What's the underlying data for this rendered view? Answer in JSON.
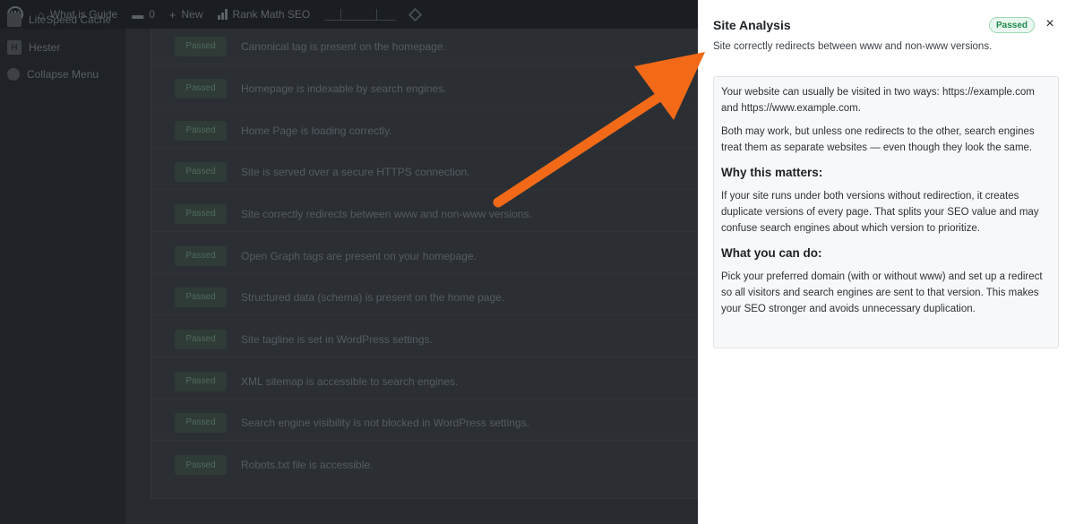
{
  "admin_bar": {
    "site_name": "What is Guide",
    "comments_count": "0",
    "new_label": "New",
    "rank_math_label": "Rank Math SEO"
  },
  "sidebar": {
    "items": [
      {
        "label": "LiteSpeed Cache",
        "icon": "litespeed-icon"
      },
      {
        "label": "Hester",
        "icon": "hester-icon"
      },
      {
        "label": "Collapse Menu",
        "icon": "collapse-icon"
      }
    ]
  },
  "checks": [
    {
      "status": "Passed",
      "text": "Canonical tag is present on the homepage."
    },
    {
      "status": "Passed",
      "text": "Homepage is indexable by search engines."
    },
    {
      "status": "Passed",
      "text": "Home Page is loading correctly."
    },
    {
      "status": "Passed",
      "text": "Site is served over a secure HTTPS connection."
    },
    {
      "status": "Passed",
      "text": "Site correctly redirects between www and non-www versions."
    },
    {
      "status": "Passed",
      "text": "Open Graph tags are present on your homepage."
    },
    {
      "status": "Passed",
      "text": "Structured data (schema) is present on the home page."
    },
    {
      "status": "Passed",
      "text": "Site tagline is set in WordPress settings."
    },
    {
      "status": "Passed",
      "text": "XML sitemap is accessible to search engines."
    },
    {
      "status": "Passed",
      "text": "Search engine visibility is not blocked in WordPress settings."
    },
    {
      "status": "Passed",
      "text": "Robots.txt file is accessible."
    }
  ],
  "drawer": {
    "title": "Site Analysis",
    "status_badge": "Passed",
    "close_glyph": "×",
    "subtitle": "Site correctly redirects between www and non-www versions.",
    "intro_1": "Your website can usually be visited in two ways: https://example.com and https://www.example.com.",
    "intro_2": "Both may work, but unless one redirects to the other, search engines treat them as separate websites — even though they look the same.",
    "why_heading": "Why this matters:",
    "why_text": "If your site runs under both versions without redirection, it creates duplicate versions of every page. That splits your SEO value and may confuse search engines about which version to prioritize.",
    "what_heading": "What you can do:",
    "what_text": "Pick your preferred domain (with or without www) and set up a redirect so all visitors and search engines are sent to that version. This makes your SEO stronger and avoids unnecessary duplication."
  },
  "colors": {
    "arrow": "#f26a18",
    "passed_badge_text": "#1f8a4c"
  }
}
